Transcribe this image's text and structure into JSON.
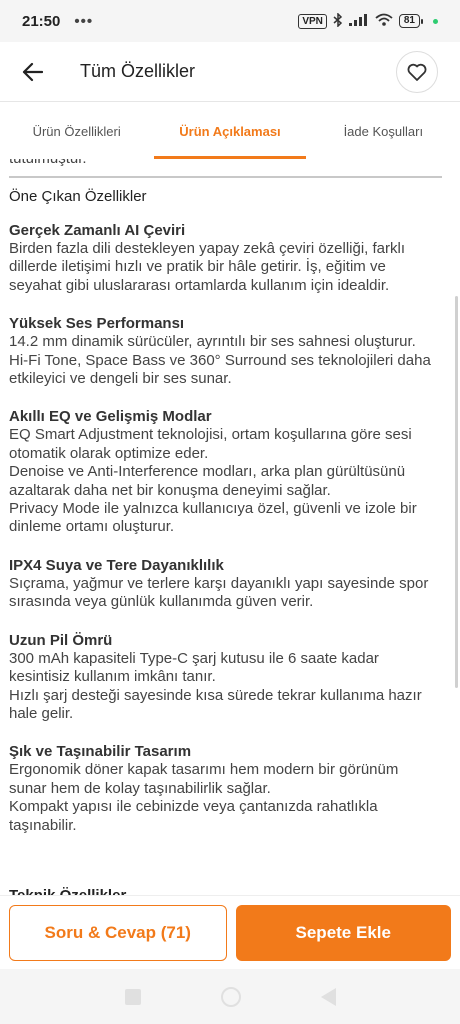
{
  "status_bar": {
    "time": "21:50",
    "dots": "•••",
    "vpn": "VPN",
    "battery": "81"
  },
  "app_bar": {
    "title": "Tüm Özellikler"
  },
  "tabs": [
    {
      "label": "Ürün Özellikleri",
      "active": false
    },
    {
      "label": "Ürün Açıklaması",
      "active": true
    },
    {
      "label": "İade Koşulları",
      "active": false
    }
  ],
  "content": {
    "cut_text": "tutulmuştur.",
    "section_heading": "Öne Çıkan Özellikler",
    "features": [
      {
        "title": "Gerçek Zamanlı AI Çeviri",
        "lines": [
          "Birden fazla dili destekleyen yapay zekâ çeviri özelliği, farklı",
          "dillerde iletişimi hızlı ve pratik bir hâle getirir. İş, eğitim ve",
          "seyahat gibi uluslararası ortamlarda kullanım için idealdir."
        ]
      },
      {
        "title": "Yüksek Ses Performansı",
        "lines": [
          "14.2 mm dinamik sürücüler, ayrıntılı bir ses sahnesi oluşturur.",
          "Hi-Fi Tone, Space Bass ve 360° Surround ses teknolojileri daha",
          "etkileyici ve dengeli bir ses sunar."
        ]
      },
      {
        "title": "Akıllı EQ ve Gelişmiş Modlar",
        "lines": [
          "EQ Smart Adjustment teknolojisi, ortam koşullarına göre sesi",
          "otomatik olarak optimize eder.",
          "Denoise ve Anti-Interference modları, arka plan gürültüsünü",
          "azaltarak daha net bir konuşma deneyimi sağlar.",
          "Privacy Mode ile yalnızca kullanıcıya özel, güvenli ve izole bir",
          "dinleme ortamı oluşturur."
        ]
      },
      {
        "title": "IPX4 Suya ve Tere Dayanıklılık",
        "lines": [
          "Sıçrama, yağmur ve terlere karşı dayanıklı yapı sayesinde spor",
          "sırasında veya günlük kullanımda güven verir."
        ]
      },
      {
        "title": "Uzun Pil Ömrü",
        "lines": [
          "300 mAh kapasiteli Type-C şarj kutusu ile 6 saate kadar",
          "kesintisiz kullanım imkânı tanır.",
          "Hızlı şarj desteği sayesinde kısa sürede tekrar kullanıma hazır",
          "hale gelir."
        ]
      },
      {
        "title": "Şık ve Taşınabilir Tasarım",
        "lines": [
          "Ergonomik döner kapak tasarımı hem modern bir görünüm",
          "sunar hem de kolay taşınabilirlik sağlar.",
          "Kompakt yapısı ile cebinizde veya çantanızda rahatlıkla",
          "taşınabilir."
        ]
      }
    ],
    "tech_heading": "Teknik Özellikler"
  },
  "bottom_bar": {
    "qa_label": "Soru & Cevap (71)",
    "cart_label": "Sepete Ekle"
  },
  "colors": {
    "accent": "#f27a1a"
  }
}
